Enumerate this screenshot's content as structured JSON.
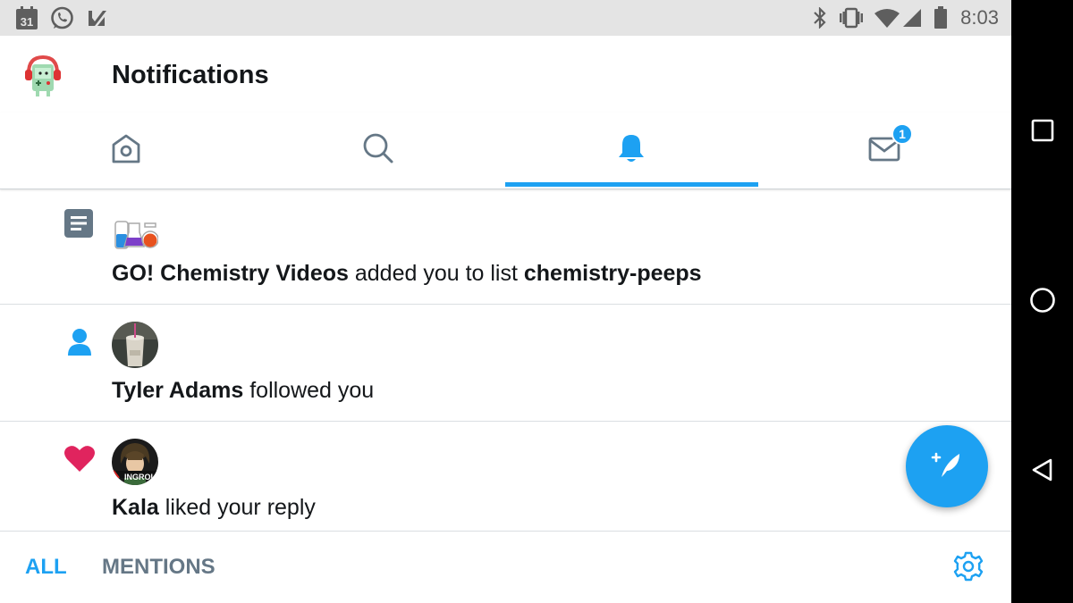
{
  "status_bar": {
    "time": "8:03",
    "calendar_day": "31",
    "icons": [
      "calendar-icon",
      "whatsapp-icon",
      "task-check-icon",
      "bluetooth-icon",
      "vibrate-icon",
      "wifi-icon",
      "signal-icon",
      "battery-icon"
    ]
  },
  "header": {
    "title": "Notifications"
  },
  "tabs": [
    {
      "name": "home",
      "icon": "home-icon",
      "active": false
    },
    {
      "name": "search",
      "icon": "search-icon",
      "active": false
    },
    {
      "name": "notifications",
      "icon": "bell-icon",
      "active": true
    },
    {
      "name": "messages",
      "icon": "mail-icon",
      "active": false,
      "badge": "1"
    }
  ],
  "notifications": [
    {
      "type_icon": "list-icon",
      "actor": "GO! Chemistry Videos",
      "action": " added you to list ",
      "target": "chemistry-peeps"
    },
    {
      "type_icon": "follow-person-icon",
      "actor": "Tyler Adams",
      "action": " followed you"
    },
    {
      "type_icon": "heart-icon",
      "actor": "Kala",
      "action": " liked your reply",
      "avatar_overlay_text": "INGROU"
    }
  ],
  "filter_bar": {
    "all_label": "ALL",
    "mentions_label": "MENTIONS",
    "active": "ALL"
  },
  "colors": {
    "accent": "#1da1f2",
    "like": "#e0245e",
    "text_primary": "#14171a",
    "text_secondary": "#657786"
  }
}
